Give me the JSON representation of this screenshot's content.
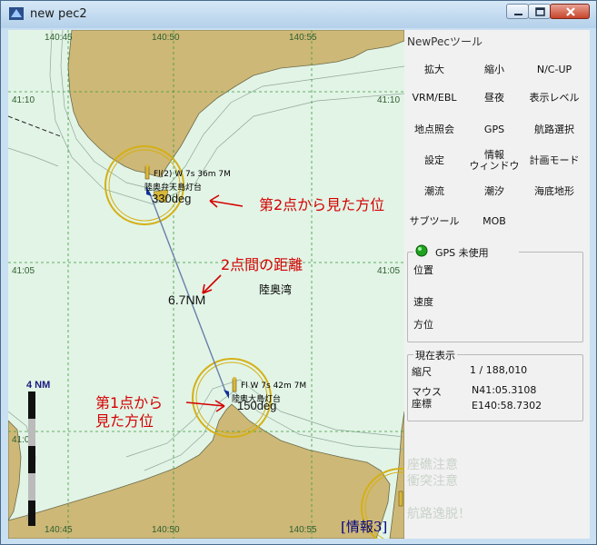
{
  "window": {
    "title": "new pec2"
  },
  "panel": {
    "title": "NewPecツール",
    "buttons": [
      {
        "label": "拡大"
      },
      {
        "label": "縮小"
      },
      {
        "label": "N/C-UP"
      },
      {
        "label": "VRM/EBL"
      },
      {
        "label": "昼夜"
      },
      {
        "label": "表示レベル"
      },
      {
        "label": "地点照会"
      },
      {
        "label": "GPS"
      },
      {
        "label": "航路選択"
      },
      {
        "label": "設定"
      },
      {
        "label_line1": "情報",
        "label_line2": "ウィンドウ"
      },
      {
        "label": "計画モード"
      },
      {
        "label": "潮流"
      },
      {
        "label": "潮汐"
      },
      {
        "label": "海底地形"
      },
      {
        "label": "サブツール"
      },
      {
        "label": "MOB"
      }
    ],
    "gps": {
      "status": "GPS 未使用",
      "position_label": "位置",
      "speed_label": "速度",
      "heading_label": "方位",
      "status_color": "#1fa31f"
    },
    "current": {
      "legend": "現在表示",
      "scale_label": "縮尺",
      "scale_value": "1 / 188,010",
      "mouse_label_line1": "マウス",
      "mouse_label_line2": "座標",
      "lat": "N41:05.3108",
      "lon": "E140:58.7302"
    },
    "warnings": [
      "座礁注意",
      "衝突注意",
      "航路逸脱！"
    ]
  },
  "chart": {
    "lon_ticks_top": [
      "140:45",
      "140:50",
      "140:55"
    ],
    "lon_ticks_bottom": [
      "140:45",
      "140:50",
      "140:55"
    ],
    "lat_ticks_left": [
      "41:10",
      "41:05",
      "41:00"
    ],
    "lat_ticks_right": [
      "41:10",
      "41:05"
    ],
    "scale_bar": "4  NM",
    "bay_name": "陸奥湾",
    "distance": "6.7NM",
    "lighthouse_upper": {
      "name": "陸奥弁天島灯台",
      "light": "Fl(2) W 7s 36m 7M",
      "bearing": "330deg"
    },
    "lighthouse_lower": {
      "name": "陸奥大島灯台",
      "light": "Fl W 7s 42m 7M",
      "bearing": "150deg"
    },
    "annotations": {
      "bearing_from_2": "第2点から見た方位",
      "distance_between": "2点間の距離",
      "bearing_from_1_line1": "第1点から",
      "bearing_from_1_line2": "見た方位"
    },
    "info_label": "[情報3]",
    "colors": {
      "land": "#cdb877",
      "sea": "#e2f4e6",
      "annotation": "#d40000",
      "ring": "#d4b015"
    }
  }
}
